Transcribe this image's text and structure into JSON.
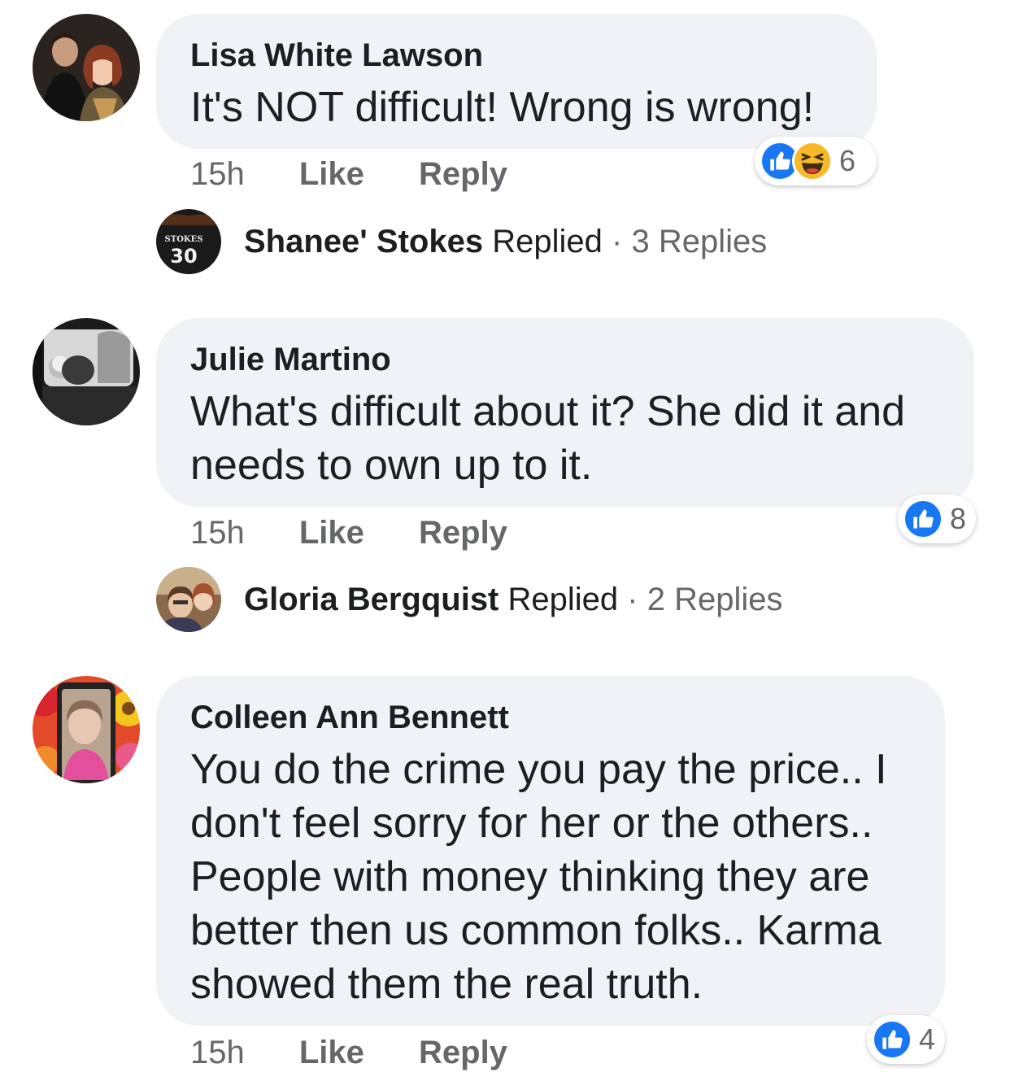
{
  "comments": [
    {
      "author": "Lisa White Lawson",
      "text": "It's NOT difficult! Wrong is wrong!",
      "time": "15h",
      "like_label": "Like",
      "reply_label": "Reply",
      "reaction_count": "6",
      "reactions": [
        "like-icon",
        "haha-icon"
      ],
      "replies": {
        "name": "Shanee' Stokes",
        "verb": "Replied",
        "separator": "·",
        "count_text": "3 Replies",
        "avatar_text": "STOKES",
        "avatar_number": "30"
      }
    },
    {
      "author": "Julie Martino",
      "text": "What's difficult about it? She did it and needs to own up to it.",
      "time": "15h",
      "like_label": "Like",
      "reply_label": "Reply",
      "reaction_count": "8",
      "reactions": [
        "like-icon"
      ],
      "replies": {
        "name": "Gloria Bergquist",
        "verb": "Replied",
        "separator": "·",
        "count_text": "2 Replies"
      }
    },
    {
      "author": "Colleen Ann Bennett",
      "text": "You do the crime you pay the price.. I don't feel sorry for her or the others.. People with money thinking they are better then us common folks.. Karma showed them the real truth.",
      "time": "15h",
      "like_label": "Like",
      "reply_label": "Reply",
      "reaction_count": "4",
      "reactions": [
        "like-icon"
      ]
    }
  ],
  "colors": {
    "bubble": "#f0f2f5",
    "like_blue": "#1877f2",
    "haha_yellow": "#f7b928",
    "meta_gray": "#65676b",
    "text": "#1c1e21"
  }
}
